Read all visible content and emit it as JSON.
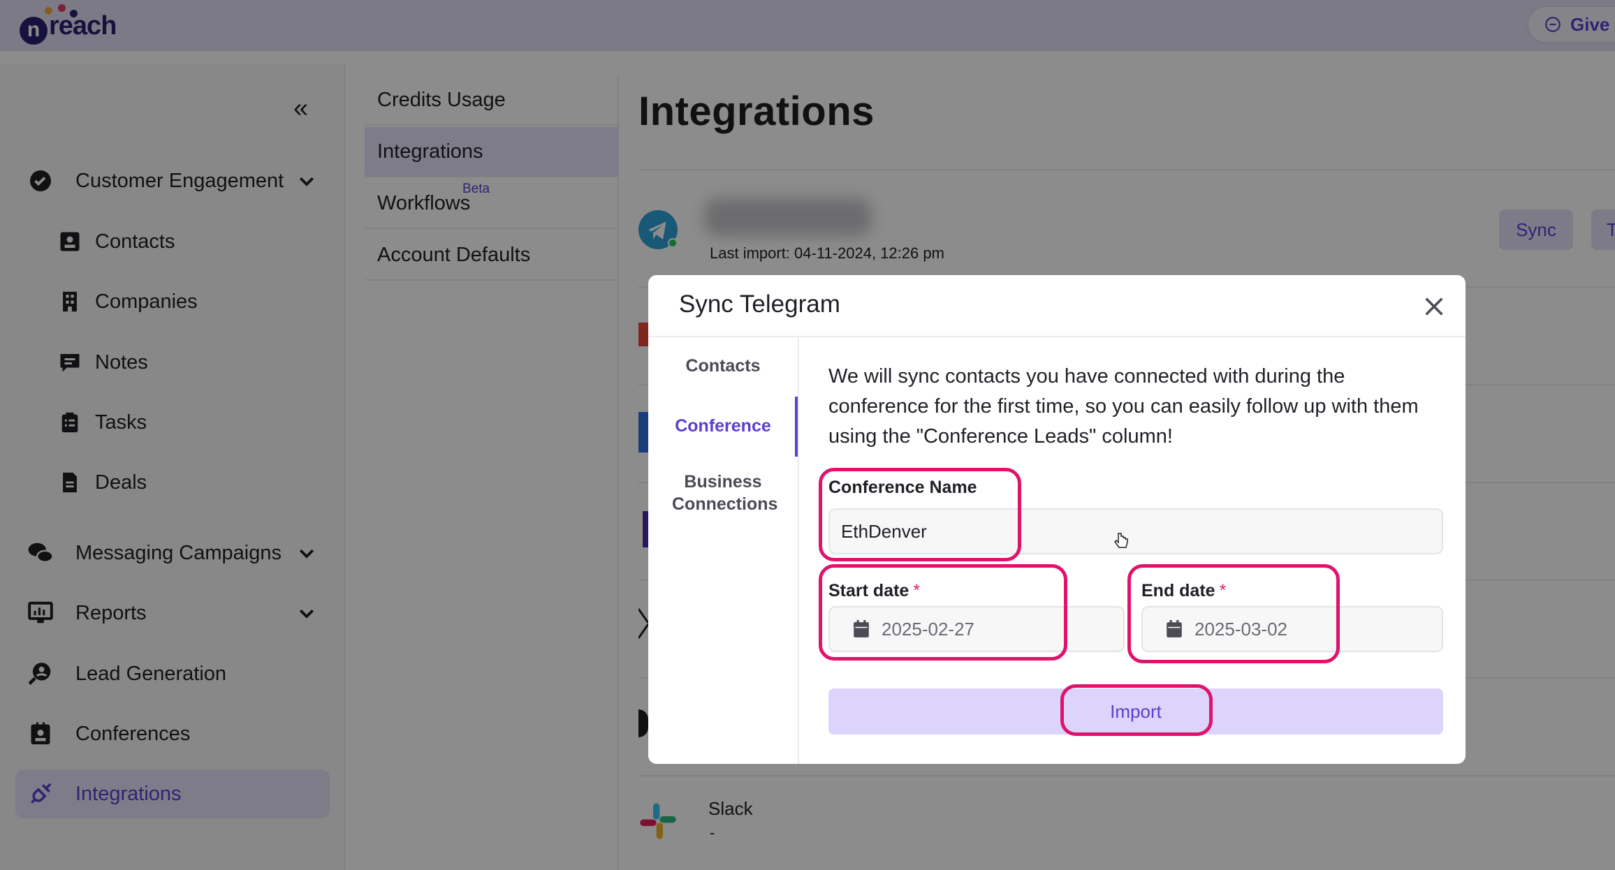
{
  "app": {
    "logo_letter": "n",
    "logo_word": "reach"
  },
  "topbar": {
    "give_label": "Give"
  },
  "leftnav": {
    "items": [
      {
        "label": "Customer Engagement"
      },
      {
        "label": "Contacts"
      },
      {
        "label": "Companies"
      },
      {
        "label": "Notes"
      },
      {
        "label": "Tasks"
      },
      {
        "label": "Deals"
      },
      {
        "label": "Messaging Campaigns"
      },
      {
        "label": "Reports"
      },
      {
        "label": "Lead Generation"
      },
      {
        "label": "Conferences"
      },
      {
        "label": "Integrations"
      }
    ]
  },
  "submenu": {
    "items": [
      {
        "label": "Credits Usage"
      },
      {
        "label": "Integrations"
      },
      {
        "label": "Workflows"
      },
      {
        "label": "Account Defaults"
      }
    ],
    "beta_badge": "Beta"
  },
  "main": {
    "title": "Integrations",
    "telegram": {
      "last_import": "Last import: 04-11-2024, 12:26 pm",
      "sync_label": "Sync",
      "second_button": "T"
    },
    "slack": {
      "label": "Slack",
      "sub": "-"
    }
  },
  "modal": {
    "title": "Sync Telegram",
    "tabs": [
      {
        "label": "Contacts"
      },
      {
        "label": "Conference"
      },
      {
        "label": "Business Connections"
      }
    ],
    "active_tab": "Conference",
    "description": "We will sync contacts you have connected with during the conference for the first time, so you can easily follow up with them using the \"Conference Leads\" column!",
    "conference_name": {
      "label": "Conference Name",
      "value": "EthDenver"
    },
    "start_date": {
      "label": "Start date",
      "required_mark": "*",
      "value": "2025-02-27"
    },
    "end_date": {
      "label": "End date",
      "required_mark": "*",
      "value": "2025-03-02"
    },
    "import_label": "Import"
  },
  "colors": {
    "accent": "#5b3fd0",
    "highlight": "#e0136b",
    "topbar": "#e2dff5"
  },
  "icons": {
    "close": "close-icon",
    "calendar": "calendar-icon",
    "telegram": "telegram-icon",
    "slack": "slack-icon"
  }
}
